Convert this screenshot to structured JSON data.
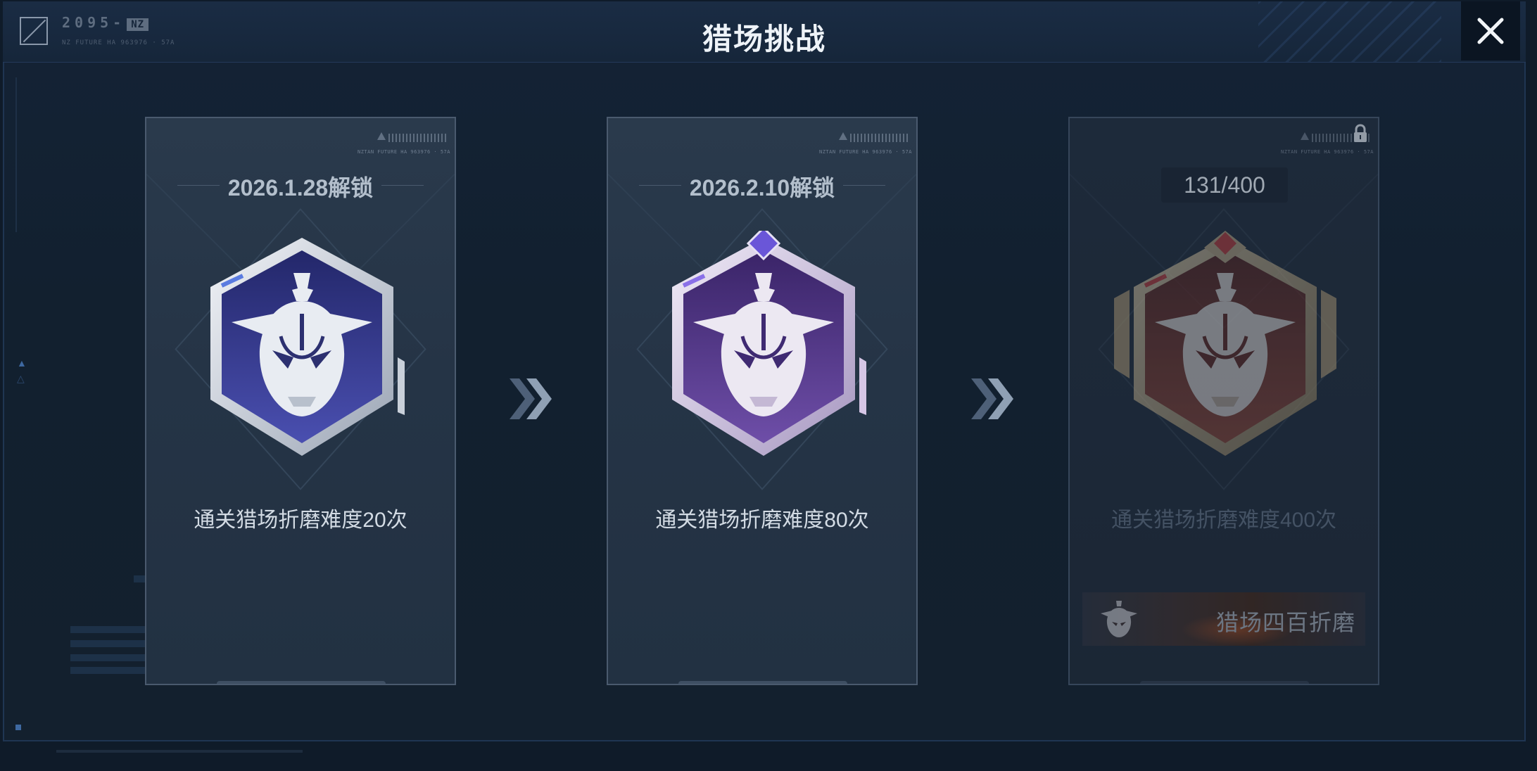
{
  "header": {
    "title": "猎场挑战",
    "logo_code": "2095-",
    "logo_tag": "NZ",
    "logo_sub": "NZ FUTURE HA 963976 · 57A",
    "close_icon": "close-icon"
  },
  "cards": [
    {
      "date": "2026.1.28解锁",
      "description": "通关猎场折磨难度20次",
      "badge_tier": "blue",
      "microtext": "NZTAN FUTURE HA 963976 · 57A",
      "colors": {
        "main": "#3a3f8c",
        "rim": "#c9d0da",
        "accent": "#5a7be0"
      }
    },
    {
      "date": "2026.2.10解锁",
      "description": "通关猎场折磨难度80次",
      "badge_tier": "purple",
      "microtext": "NZTAN FUTURE HA 963976 · 57A",
      "colors": {
        "main": "#5a3f8a",
        "rim": "#d6c6e6",
        "accent": "#6a56d8"
      }
    },
    {
      "progress": "131/400",
      "description": "通关猎场折磨难度400次",
      "badge_tier": "red",
      "locked": true,
      "microtext": "NZTAN FUTURE HA 963976 · 57A",
      "reward_label": "猎场四百折磨",
      "colors": {
        "main": "#7a3a30",
        "rim": "#c8b48e",
        "accent": "#d24040"
      }
    }
  ]
}
